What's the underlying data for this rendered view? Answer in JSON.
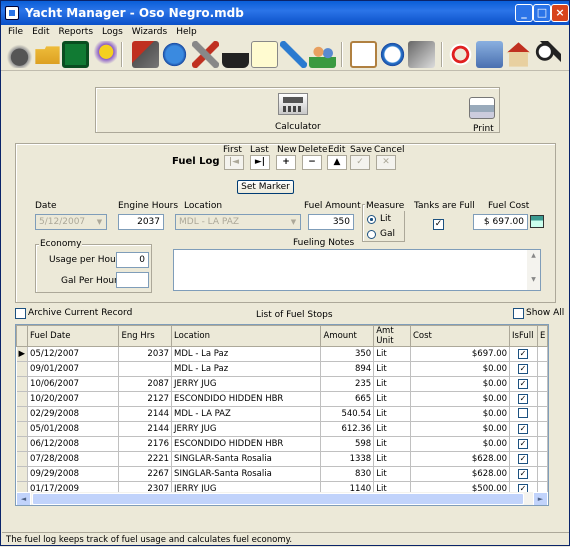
{
  "window": {
    "title": "Yacht Manager - Oso Negro.mdb"
  },
  "menu": [
    "File",
    "Edit",
    "Reports",
    "Logs",
    "Wizards",
    "Help"
  ],
  "toolbar_icons": [
    "disk-drive-icon",
    "open-folder-icon",
    "save-icon",
    "wizard-icon",
    "fuel-log-icon",
    "globe-icon",
    "tools-icon",
    "lock-icon",
    "notepad-icon",
    "wrench-icon",
    "people-icon",
    "clipboard-icon",
    "clock-icon",
    "calculator-icon",
    "life-ring-icon",
    "server-icon",
    "house-icon",
    "magnifier-icon"
  ],
  "calculator": {
    "label": "Calculator"
  },
  "print": {
    "label": "Print"
  },
  "fuel_log": {
    "title": "Fuel Log"
  },
  "nav": {
    "first": "First",
    "last": "Last",
    "new": "New",
    "delete": "Delete",
    "edit": "Edit",
    "save": "Save",
    "cancel": "Cancel"
  },
  "set_marker": "Set Marker",
  "form": {
    "date_label": "Date",
    "date_value": "5/12/2007",
    "engine_hours_label": "Engine Hours",
    "engine_hours_value": "2037",
    "location_label": "Location",
    "location_value": "MDL - LA PAZ",
    "fuel_amount_label": "Fuel Amount",
    "fuel_amount_value": "350",
    "measure_label": "Measure",
    "lit_label": "Lit",
    "gal_label": "Gal",
    "tanks_full_label": "Tanks are Full",
    "fuel_cost_label": "Fuel Cost",
    "fuel_cost_value": "$ 697.00",
    "fueling_notes_label": "Fueling Notes"
  },
  "economy": {
    "title": "Economy",
    "usage_label": "Usage per Hour",
    "usage_value": "0",
    "gal_label": "Gal Per Hour",
    "gal_value": ""
  },
  "archive_label": "Archive Current Record",
  "list_title": "List of Fuel Stops",
  "show_all_label": "Show All",
  "grid": {
    "columns": [
      "Fuel Date",
      "Eng Hrs",
      "Location",
      "Amount",
      "Amt Unit",
      "Cost",
      "IsFull",
      "E"
    ],
    "rows": [
      [
        "05/12/2007",
        "2037",
        "MDL - La Paz",
        "350",
        "Lit",
        "$697.00",
        true
      ],
      [
        "09/01/2007",
        "",
        "MDL - La Paz",
        "894",
        "Lit",
        "$0.00",
        true
      ],
      [
        "10/06/2007",
        "2087",
        "JERRY JUG",
        "235",
        "Lit",
        "$0.00",
        true
      ],
      [
        "10/20/2007",
        "2127",
        "ESCONDIDO HIDDEN HBR",
        "665",
        "Lit",
        "$0.00",
        true
      ],
      [
        "02/29/2008",
        "2144",
        "MDL - LA PAZ",
        "540.54",
        "Lit",
        "$0.00",
        false
      ],
      [
        "05/01/2008",
        "2144",
        "JERRY JUG",
        "612.36",
        "Lit",
        "$0.00",
        true
      ],
      [
        "06/12/2008",
        "2176",
        "ESCONDIDO HIDDEN HBR",
        "598",
        "Lit",
        "$0.00",
        true
      ],
      [
        "07/28/2008",
        "2221",
        "SINGLAR-Santa Rosalia",
        "1338",
        "Lit",
        "$628.00",
        true
      ],
      [
        "09/29/2008",
        "2267",
        "SINGLAR-Santa Rosalia",
        "830",
        "Lit",
        "$628.00",
        true
      ],
      [
        "01/17/2009",
        "2307",
        "JERRY JUG",
        "1140",
        "Lit",
        "$500.00",
        true
      ]
    ]
  },
  "status": "The fuel log keeps track of fuel usage and calculates fuel economy."
}
